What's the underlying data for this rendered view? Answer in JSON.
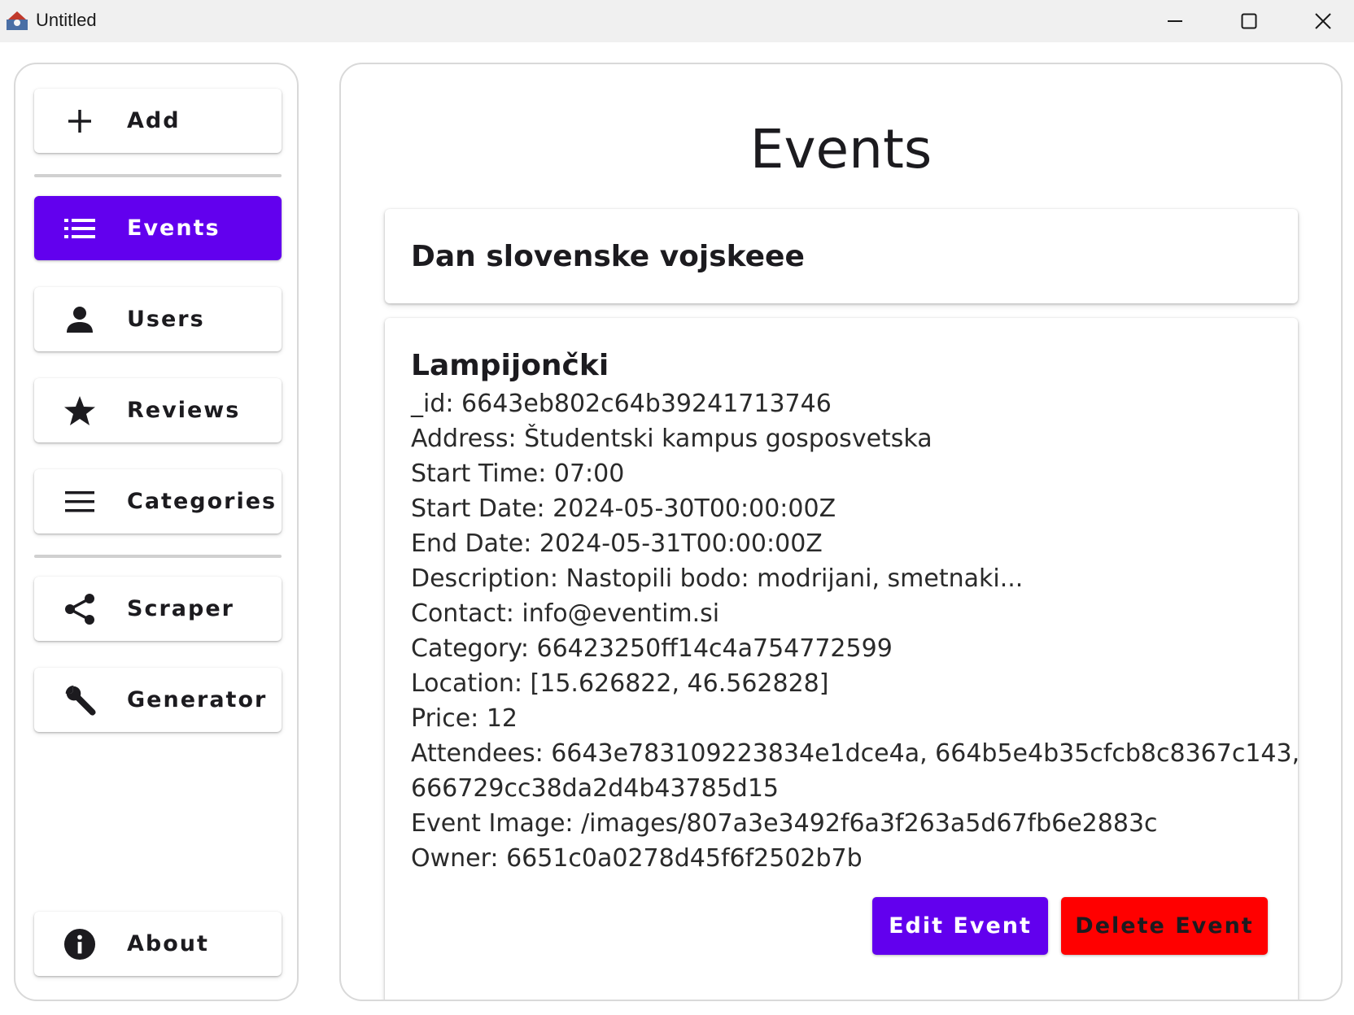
{
  "window": {
    "title": "Untitled"
  },
  "sidebar": {
    "items": [
      {
        "label": "Add",
        "icon": "plus-icon"
      },
      {
        "label": "Events",
        "icon": "list-icon",
        "active": true
      },
      {
        "label": "Users",
        "icon": "person-icon"
      },
      {
        "label": "Reviews",
        "icon": "star-icon"
      },
      {
        "label": "Categories",
        "icon": "menu-icon"
      },
      {
        "label": "Scraper",
        "icon": "share-icon"
      },
      {
        "label": "Generator",
        "icon": "wrench-icon"
      },
      {
        "label": "About",
        "icon": "info-icon"
      }
    ]
  },
  "main": {
    "title": "Events",
    "events": [
      {
        "name": "Dan slovenske vojskeee"
      },
      {
        "name": "Lampijončki",
        "fields": [
          "_id: 6643eb802c64b39241713746",
          "Address: Študentski kampus gosposvetska",
          "Start Time: 07:00",
          "Start Date: 2024-05-30T00:00:00Z",
          "End Date: 2024-05-31T00:00:00Z",
          "Description: Nastopili bodo: modrijani, smetnaki...",
          "Contact: info@eventim.si",
          "Category: 66423250ff14c4a754772599",
          "Location: [15.626822, 46.562828]",
          "Price: 12",
          "Attendees: 6643e783109223834e1dce4a, 664b5e4b35cfcb8c8367c143,",
          "666729cc38da2d4b43785d15",
          "Event Image: /images/807a3e3492f6a3f263a5d67fb6e2883c",
          "Owner: 6651c0a0278d45f6f2502b7b"
        ],
        "edit_label": "Edit Event",
        "delete_label": "Delete Event"
      }
    ]
  },
  "colors": {
    "accent": "#6200ee",
    "danger": "#ff0000"
  }
}
